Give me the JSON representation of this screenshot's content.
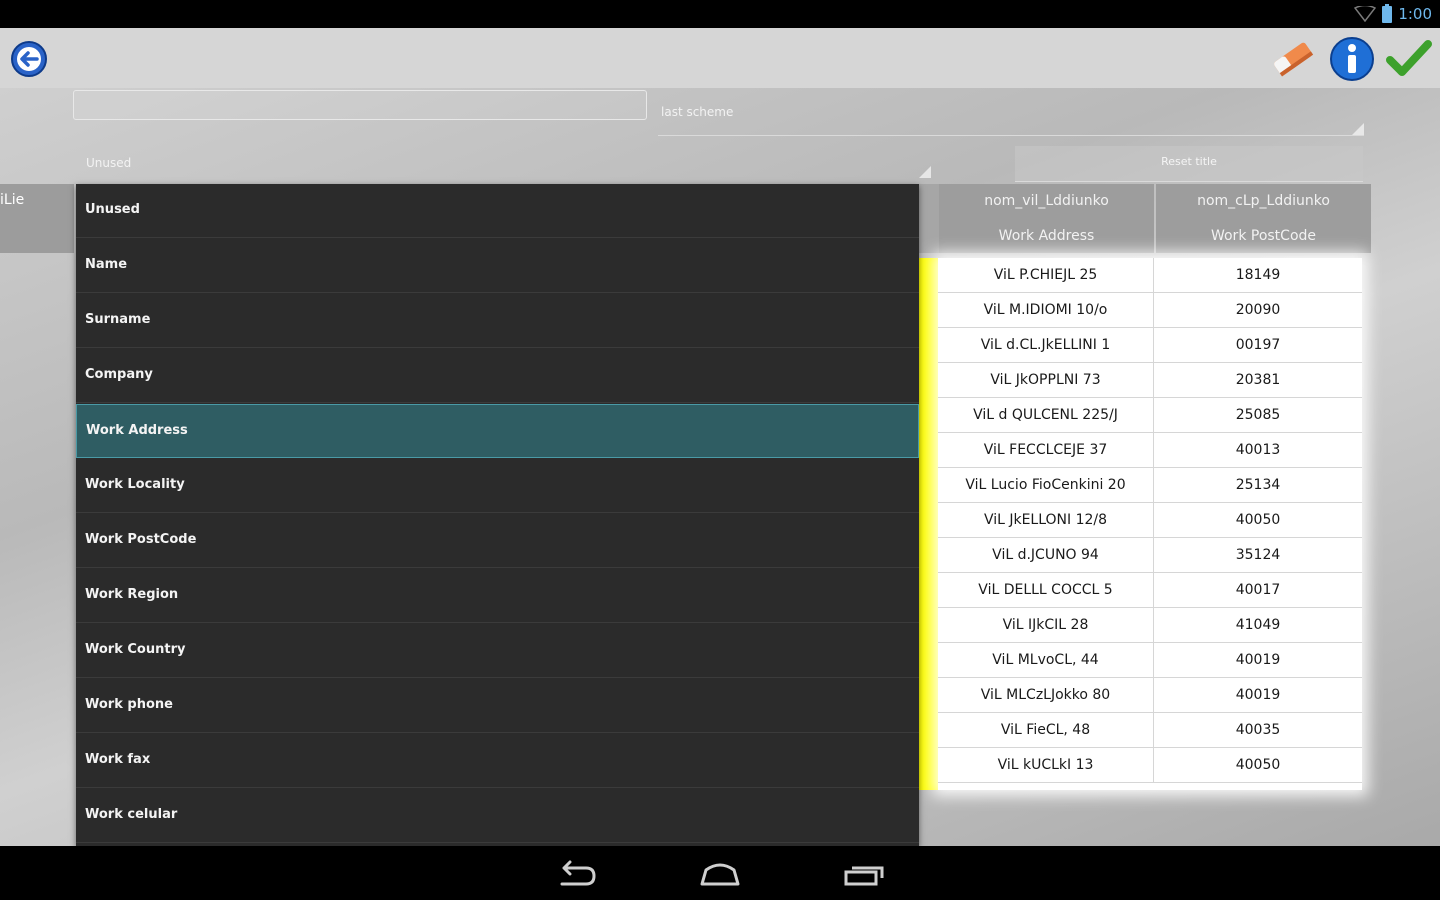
{
  "status_bar": {
    "time": "1:00"
  },
  "toolbar": {
    "back_icon": "back-arrow-icon",
    "eraser_icon": "eraser-icon",
    "info_icon": "info-icon",
    "confirm_icon": "checkmark-icon"
  },
  "scheme": {
    "name_value": "",
    "label": "last scheme"
  },
  "column_selector": {
    "selected": "Unused"
  },
  "reset_title_label": "Reset title",
  "left_partial_header": "iLie",
  "table": {
    "headers": [
      {
        "field": "nom_vil_Lddiunko",
        "title": "Work Address"
      },
      {
        "field": "nom_cLp_Lddiunko",
        "title": "Work PostCode"
      }
    ],
    "rows": [
      [
        "ViL P.CHIEJL 25",
        "18149"
      ],
      [
        "ViL M.IDIOMI 10/o",
        "20090"
      ],
      [
        "ViL d.CL.JkELLINI 1",
        "00197"
      ],
      [
        "ViL JkOPPLNI 73",
        "20381"
      ],
      [
        "ViL d QULCENL 225/J",
        "25085"
      ],
      [
        "ViL FECCLCEJE 37",
        "40013"
      ],
      [
        "ViL Lucio FioCenkini 20",
        "25134"
      ],
      [
        "ViL JkELLONI 12/8",
        "40050"
      ],
      [
        "ViL d.JCUNO 94",
        "35124"
      ],
      [
        "ViL DELLL COCCL 5",
        "40017"
      ],
      [
        "ViL IJkCIL 28",
        "41049"
      ],
      [
        "ViL MLvoCL, 44",
        "40019"
      ],
      [
        "ViL MLCzLJokko 80",
        "40019"
      ],
      [
        "ViL FieCL, 48",
        "40035"
      ],
      [
        "ViL kUCLkI 13",
        "40050"
      ]
    ]
  },
  "dropdown": {
    "items": [
      "Unused",
      "Name",
      "Surname",
      "Company",
      "Work Address",
      "Work Locality",
      "Work PostCode",
      "Work Region",
      "Work Country",
      "Work phone",
      "Work fax",
      "Work celular"
    ],
    "selected_index": 4
  },
  "nav": {
    "back_icon": "nav-back-icon",
    "home_icon": "nav-home-icon",
    "recents_icon": "nav-recents-icon"
  }
}
